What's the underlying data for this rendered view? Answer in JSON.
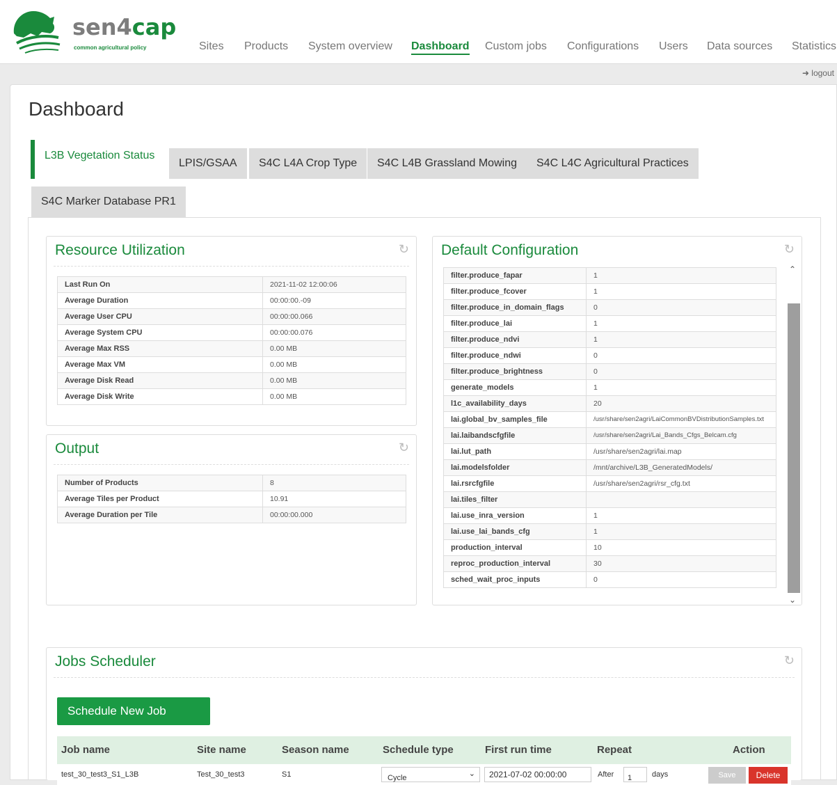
{
  "brand": {
    "name_a": "sen4",
    "name_b": "cap",
    "tagline": "common agricultural policy"
  },
  "nav": [
    "Sites",
    "Products",
    "System overview",
    "Dashboard",
    "Custom jobs",
    "Configurations",
    "Users",
    "Data sources",
    "Statistics"
  ],
  "nav_active": "Dashboard",
  "logout": "logout",
  "page_title": "Dashboard",
  "tabs": [
    "L3B Vegetation Status",
    "LPIS/GSAA",
    "S4C L4A Crop Type",
    "S4C L4B Grassland Mowing",
    "S4C L4C Agricultural Practices",
    "S4C Marker Database PR1"
  ],
  "resource": {
    "title": "Resource Utilization",
    "rows": [
      {
        "k": "Last Run On",
        "v": "2021-11-02 12:00:06"
      },
      {
        "k": "Average Duration",
        "v": "00:00:00.-09"
      },
      {
        "k": "Average User CPU",
        "v": "00:00:00.066"
      },
      {
        "k": "Average System CPU",
        "v": "00:00:00.076"
      },
      {
        "k": "Average Max RSS",
        "v": "0.00 MB"
      },
      {
        "k": "Average Max VM",
        "v": "0.00 MB"
      },
      {
        "k": "Average Disk Read",
        "v": "0.00 MB"
      },
      {
        "k": "Average Disk Write",
        "v": "0.00 MB"
      }
    ]
  },
  "output": {
    "title": "Output",
    "rows": [
      {
        "k": "Number of Products",
        "v": "8"
      },
      {
        "k": "Average Tiles per Product",
        "v": "10.91"
      },
      {
        "k": "Average Duration per Tile",
        "v": "00:00:00.000"
      }
    ]
  },
  "config": {
    "title": "Default Configuration",
    "rows": [
      {
        "k": "filter.produce_fapar",
        "v": "1"
      },
      {
        "k": "filter.produce_fcover",
        "v": "1"
      },
      {
        "k": "filter.produce_in_domain_flags",
        "v": "0"
      },
      {
        "k": "filter.produce_lai",
        "v": "1"
      },
      {
        "k": "filter.produce_ndvi",
        "v": "1"
      },
      {
        "k": "filter.produce_ndwi",
        "v": "0"
      },
      {
        "k": "filter.produce_brightness",
        "v": "0"
      },
      {
        "k": "generate_models",
        "v": "1"
      },
      {
        "k": "l1c_availability_days",
        "v": "20"
      },
      {
        "k": "lai.global_bv_samples_file",
        "v": "/usr/share/sen2agri/LaiCommonBVDistributionSamples.txt"
      },
      {
        "k": "lai.laibandscfgfile",
        "v": "/usr/share/sen2agri/Lai_Bands_Cfgs_Belcam.cfg"
      },
      {
        "k": "lai.lut_path",
        "v": "/usr/share/sen2agri/lai.map"
      },
      {
        "k": "lai.modelsfolder",
        "v": "/mnt/archive/L3B_GeneratedModels/"
      },
      {
        "k": "lai.rsrcfgfile",
        "v": "/usr/share/sen2agri/rsr_cfg.txt"
      },
      {
        "k": "lai.tiles_filter",
        "v": ""
      },
      {
        "k": "lai.use_inra_version",
        "v": "1"
      },
      {
        "k": "lai.use_lai_bands_cfg",
        "v": "1"
      },
      {
        "k": "production_interval",
        "v": "10"
      },
      {
        "k": "reproc_production_interval",
        "v": "30"
      },
      {
        "k": "sched_wait_proc_inputs",
        "v": "0"
      }
    ]
  },
  "jobs": {
    "title": "Jobs Scheduler",
    "new_button": "Schedule New Job",
    "headers": [
      "Job name",
      "Site name",
      "Season name",
      "Schedule type",
      "First run time",
      "Repeat",
      "Action"
    ],
    "row": {
      "job": "test_30_test3_S1_L3B",
      "site": "Test_30_test3",
      "season": "S1",
      "schedule": "Cycle",
      "first_run": "2021-07-02 00:00:00",
      "repeat_prefix": "After",
      "repeat_value": "1",
      "repeat_suffix": "days",
      "save": "Save",
      "delete": "Delete"
    }
  },
  "colors": {
    "accent": "#1a8a3c",
    "danger": "#d9342b"
  }
}
